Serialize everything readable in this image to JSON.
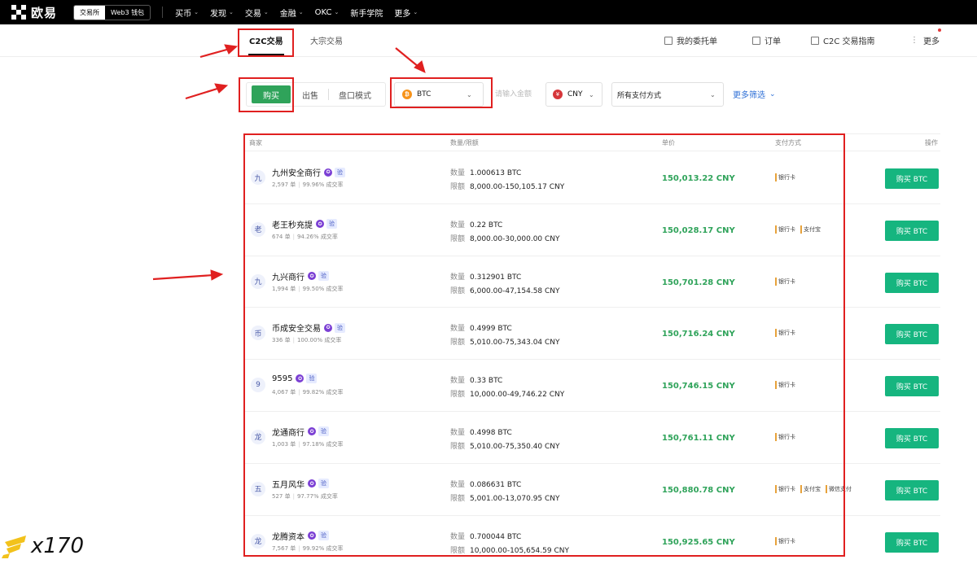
{
  "topbar": {
    "brand": "欧易",
    "modes": [
      "交易所",
      "Web3 钱包"
    ],
    "nav": [
      "买币",
      "发现",
      "交易",
      "金融",
      "OKC",
      "新手学院",
      "更多"
    ],
    "nav_has_chevron": [
      true,
      true,
      true,
      true,
      true,
      false,
      true
    ]
  },
  "subtabs": {
    "tabs": [
      "C2C交易",
      "大宗交易"
    ],
    "links": [
      "我的委托单",
      "订单",
      "C2C 交易指南",
      "更多"
    ]
  },
  "filters": {
    "buy": "购买",
    "sell": "出售",
    "orderbook": "盘口模式",
    "coin": "BTC",
    "amount_placeholder": "请输入金额",
    "fiat": "CNY",
    "payment": "所有支付方式",
    "more": "更多筛选"
  },
  "table": {
    "headers": [
      "商家",
      "数量/限额",
      "单价",
      "支付方式",
      "操作"
    ],
    "qty_label": "数量",
    "limit_label": "限额",
    "verified_label": "验",
    "orders_suffix": "单",
    "rate_suffix": "成交率",
    "rows": [
      {
        "avatar": "九",
        "name": "九州安全商行",
        "orders": "2,597 单",
        "rate": "99.96% 成交率",
        "qty": "1.000613 BTC",
        "limit": "8,000.00-150,105.17 CNY",
        "price": "150,013.22 CNY",
        "payments": [
          "银行卡"
        ],
        "action": "购买 BTC"
      },
      {
        "avatar": "老",
        "name": "老王秒充提",
        "orders": "674 单",
        "rate": "94.26% 成交率",
        "qty": "0.22 BTC",
        "limit": "8,000.00-30,000.00 CNY",
        "price": "150,028.17 CNY",
        "payments": [
          "银行卡",
          "支付宝"
        ],
        "action": "购买 BTC"
      },
      {
        "avatar": "九",
        "name": "九兴商行",
        "orders": "1,994 单",
        "rate": "99.50% 成交率",
        "qty": "0.312901 BTC",
        "limit": "6,000.00-47,154.58 CNY",
        "price": "150,701.28 CNY",
        "payments": [
          "银行卡"
        ],
        "action": "购买 BTC"
      },
      {
        "avatar": "币",
        "name": "币成安全交易",
        "orders": "336 单",
        "rate": "100.00% 成交率",
        "qty": "0.4999 BTC",
        "limit": "5,010.00-75,343.04 CNY",
        "price": "150,716.24 CNY",
        "payments": [
          "银行卡"
        ],
        "action": "购买 BTC"
      },
      {
        "avatar": "9",
        "name": "9595",
        "orders": "4,067 单",
        "rate": "99.82% 成交率",
        "qty": "0.33 BTC",
        "limit": "10,000.00-49,746.22 CNY",
        "price": "150,746.15 CNY",
        "payments": [
          "银行卡"
        ],
        "action": "购买 BTC"
      },
      {
        "avatar": "龙",
        "name": "龙通商行",
        "orders": "1,003 单",
        "rate": "97.18% 成交率",
        "qty": "0.4998 BTC",
        "limit": "5,010.00-75,350.40 CNY",
        "price": "150,761.11 CNY",
        "payments": [
          "银行卡"
        ],
        "action": "购买 BTC"
      },
      {
        "avatar": "五",
        "name": "五月风华",
        "orders": "527 单",
        "rate": "97.77% 成交率",
        "qty": "0.086631 BTC",
        "limit": "5,001.00-13,070.95 CNY",
        "price": "150,880.78 CNY",
        "payments": [
          "银行卡",
          "支付宝",
          "微信支付"
        ],
        "action": "购买 BTC"
      },
      {
        "avatar": "龙",
        "name": "龙腾资本",
        "orders": "7,567 单",
        "rate": "99.92% 成交率",
        "qty": "0.700044 BTC",
        "limit": "10,000.00-105,654.59 CNY",
        "price": "150,925.65 CNY",
        "payments": [
          "银行卡"
        ],
        "action": "购买 BTC"
      }
    ]
  },
  "watermark": "x170",
  "colors": {
    "buy_green": "#2fa35a",
    "price_green": "#2fa35a",
    "action_green": "#16b57f",
    "annotation_red": "#e02020",
    "link_blue": "#2e6fd6",
    "btc_orange": "#f7931a"
  }
}
